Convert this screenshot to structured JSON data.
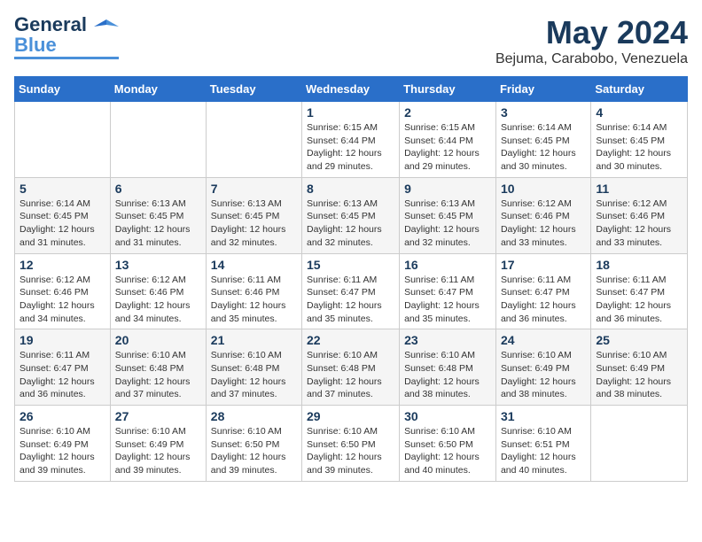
{
  "header": {
    "logo_line1": "General",
    "logo_line2": "Blue",
    "month_title": "May 2024",
    "location": "Bejuma, Carabobo, Venezuela"
  },
  "days_of_week": [
    "Sunday",
    "Monday",
    "Tuesday",
    "Wednesday",
    "Thursday",
    "Friday",
    "Saturday"
  ],
  "weeks": [
    [
      {
        "day": "",
        "info": ""
      },
      {
        "day": "",
        "info": ""
      },
      {
        "day": "",
        "info": ""
      },
      {
        "day": "1",
        "info": "Sunrise: 6:15 AM\nSunset: 6:44 PM\nDaylight: 12 hours\nand 29 minutes."
      },
      {
        "day": "2",
        "info": "Sunrise: 6:15 AM\nSunset: 6:44 PM\nDaylight: 12 hours\nand 29 minutes."
      },
      {
        "day": "3",
        "info": "Sunrise: 6:14 AM\nSunset: 6:45 PM\nDaylight: 12 hours\nand 30 minutes."
      },
      {
        "day": "4",
        "info": "Sunrise: 6:14 AM\nSunset: 6:45 PM\nDaylight: 12 hours\nand 30 minutes."
      }
    ],
    [
      {
        "day": "5",
        "info": "Sunrise: 6:14 AM\nSunset: 6:45 PM\nDaylight: 12 hours\nand 31 minutes."
      },
      {
        "day": "6",
        "info": "Sunrise: 6:13 AM\nSunset: 6:45 PM\nDaylight: 12 hours\nand 31 minutes."
      },
      {
        "day": "7",
        "info": "Sunrise: 6:13 AM\nSunset: 6:45 PM\nDaylight: 12 hours\nand 32 minutes."
      },
      {
        "day": "8",
        "info": "Sunrise: 6:13 AM\nSunset: 6:45 PM\nDaylight: 12 hours\nand 32 minutes."
      },
      {
        "day": "9",
        "info": "Sunrise: 6:13 AM\nSunset: 6:45 PM\nDaylight: 12 hours\nand 32 minutes."
      },
      {
        "day": "10",
        "info": "Sunrise: 6:12 AM\nSunset: 6:46 PM\nDaylight: 12 hours\nand 33 minutes."
      },
      {
        "day": "11",
        "info": "Sunrise: 6:12 AM\nSunset: 6:46 PM\nDaylight: 12 hours\nand 33 minutes."
      }
    ],
    [
      {
        "day": "12",
        "info": "Sunrise: 6:12 AM\nSunset: 6:46 PM\nDaylight: 12 hours\nand 34 minutes."
      },
      {
        "day": "13",
        "info": "Sunrise: 6:12 AM\nSunset: 6:46 PM\nDaylight: 12 hours\nand 34 minutes."
      },
      {
        "day": "14",
        "info": "Sunrise: 6:11 AM\nSunset: 6:46 PM\nDaylight: 12 hours\nand 35 minutes."
      },
      {
        "day": "15",
        "info": "Sunrise: 6:11 AM\nSunset: 6:47 PM\nDaylight: 12 hours\nand 35 minutes."
      },
      {
        "day": "16",
        "info": "Sunrise: 6:11 AM\nSunset: 6:47 PM\nDaylight: 12 hours\nand 35 minutes."
      },
      {
        "day": "17",
        "info": "Sunrise: 6:11 AM\nSunset: 6:47 PM\nDaylight: 12 hours\nand 36 minutes."
      },
      {
        "day": "18",
        "info": "Sunrise: 6:11 AM\nSunset: 6:47 PM\nDaylight: 12 hours\nand 36 minutes."
      }
    ],
    [
      {
        "day": "19",
        "info": "Sunrise: 6:11 AM\nSunset: 6:47 PM\nDaylight: 12 hours\nand 36 minutes."
      },
      {
        "day": "20",
        "info": "Sunrise: 6:10 AM\nSunset: 6:48 PM\nDaylight: 12 hours\nand 37 minutes."
      },
      {
        "day": "21",
        "info": "Sunrise: 6:10 AM\nSunset: 6:48 PM\nDaylight: 12 hours\nand 37 minutes."
      },
      {
        "day": "22",
        "info": "Sunrise: 6:10 AM\nSunset: 6:48 PM\nDaylight: 12 hours\nand 37 minutes."
      },
      {
        "day": "23",
        "info": "Sunrise: 6:10 AM\nSunset: 6:48 PM\nDaylight: 12 hours\nand 38 minutes."
      },
      {
        "day": "24",
        "info": "Sunrise: 6:10 AM\nSunset: 6:49 PM\nDaylight: 12 hours\nand 38 minutes."
      },
      {
        "day": "25",
        "info": "Sunrise: 6:10 AM\nSunset: 6:49 PM\nDaylight: 12 hours\nand 38 minutes."
      }
    ],
    [
      {
        "day": "26",
        "info": "Sunrise: 6:10 AM\nSunset: 6:49 PM\nDaylight: 12 hours\nand 39 minutes."
      },
      {
        "day": "27",
        "info": "Sunrise: 6:10 AM\nSunset: 6:49 PM\nDaylight: 12 hours\nand 39 minutes."
      },
      {
        "day": "28",
        "info": "Sunrise: 6:10 AM\nSunset: 6:50 PM\nDaylight: 12 hours\nand 39 minutes."
      },
      {
        "day": "29",
        "info": "Sunrise: 6:10 AM\nSunset: 6:50 PM\nDaylight: 12 hours\nand 39 minutes."
      },
      {
        "day": "30",
        "info": "Sunrise: 6:10 AM\nSunset: 6:50 PM\nDaylight: 12 hours\nand 40 minutes."
      },
      {
        "day": "31",
        "info": "Sunrise: 6:10 AM\nSunset: 6:51 PM\nDaylight: 12 hours\nand 40 minutes."
      },
      {
        "day": "",
        "info": ""
      }
    ]
  ]
}
